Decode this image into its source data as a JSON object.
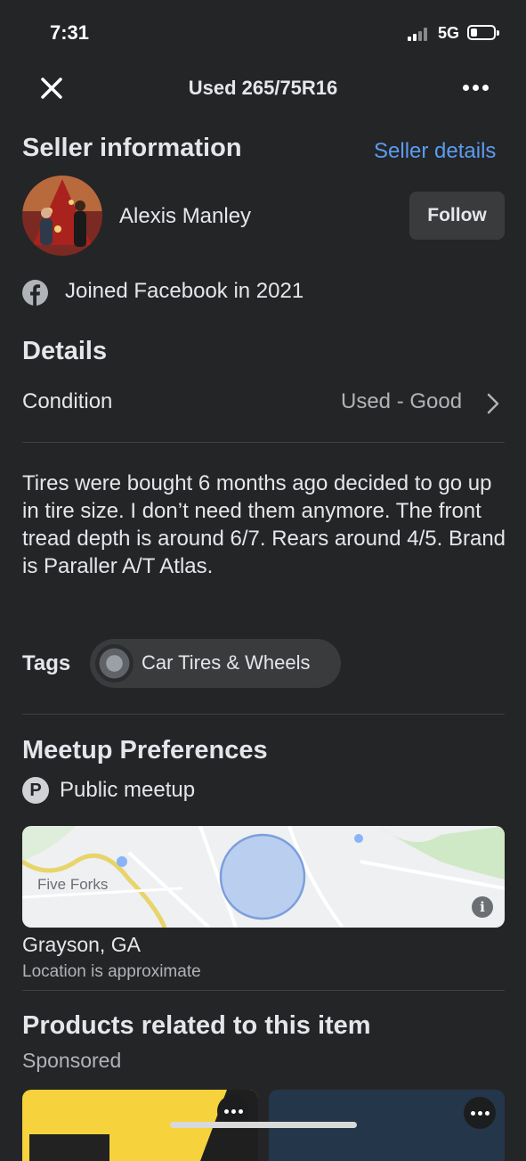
{
  "status_bar": {
    "time": "7:31",
    "network": "5G"
  },
  "top_bar": {
    "title": "Used 265/75R16"
  },
  "seller": {
    "heading": "Seller information",
    "details_link": "Seller details",
    "name": "Alexis Manley",
    "follow_label": "Follow",
    "joined": "Joined Facebook in 2021"
  },
  "details": {
    "heading": "Details",
    "condition_label": "Condition",
    "condition_value": "Used - Good",
    "description": "Tires were bought 6 months ago decided to go up in tire size. I don’t need them anymore. The front tread depth is around 6/7. Rears around 4/5. Brand is Paraller A/T Atlas."
  },
  "tags": {
    "label": "Tags",
    "items": [
      {
        "label": "Car Tires & Wheels"
      }
    ]
  },
  "meetup": {
    "heading": "Meetup Preferences",
    "type": "Public meetup",
    "map_label": "Five Forks",
    "city": "Grayson, GA",
    "approx_note": "Location is approximate"
  },
  "products": {
    "heading": "Products related to this item",
    "sponsored": "Sponsored"
  },
  "colors": {
    "background": "#242526",
    "link": "#5b9cf1",
    "chip": "#3a3b3c"
  }
}
